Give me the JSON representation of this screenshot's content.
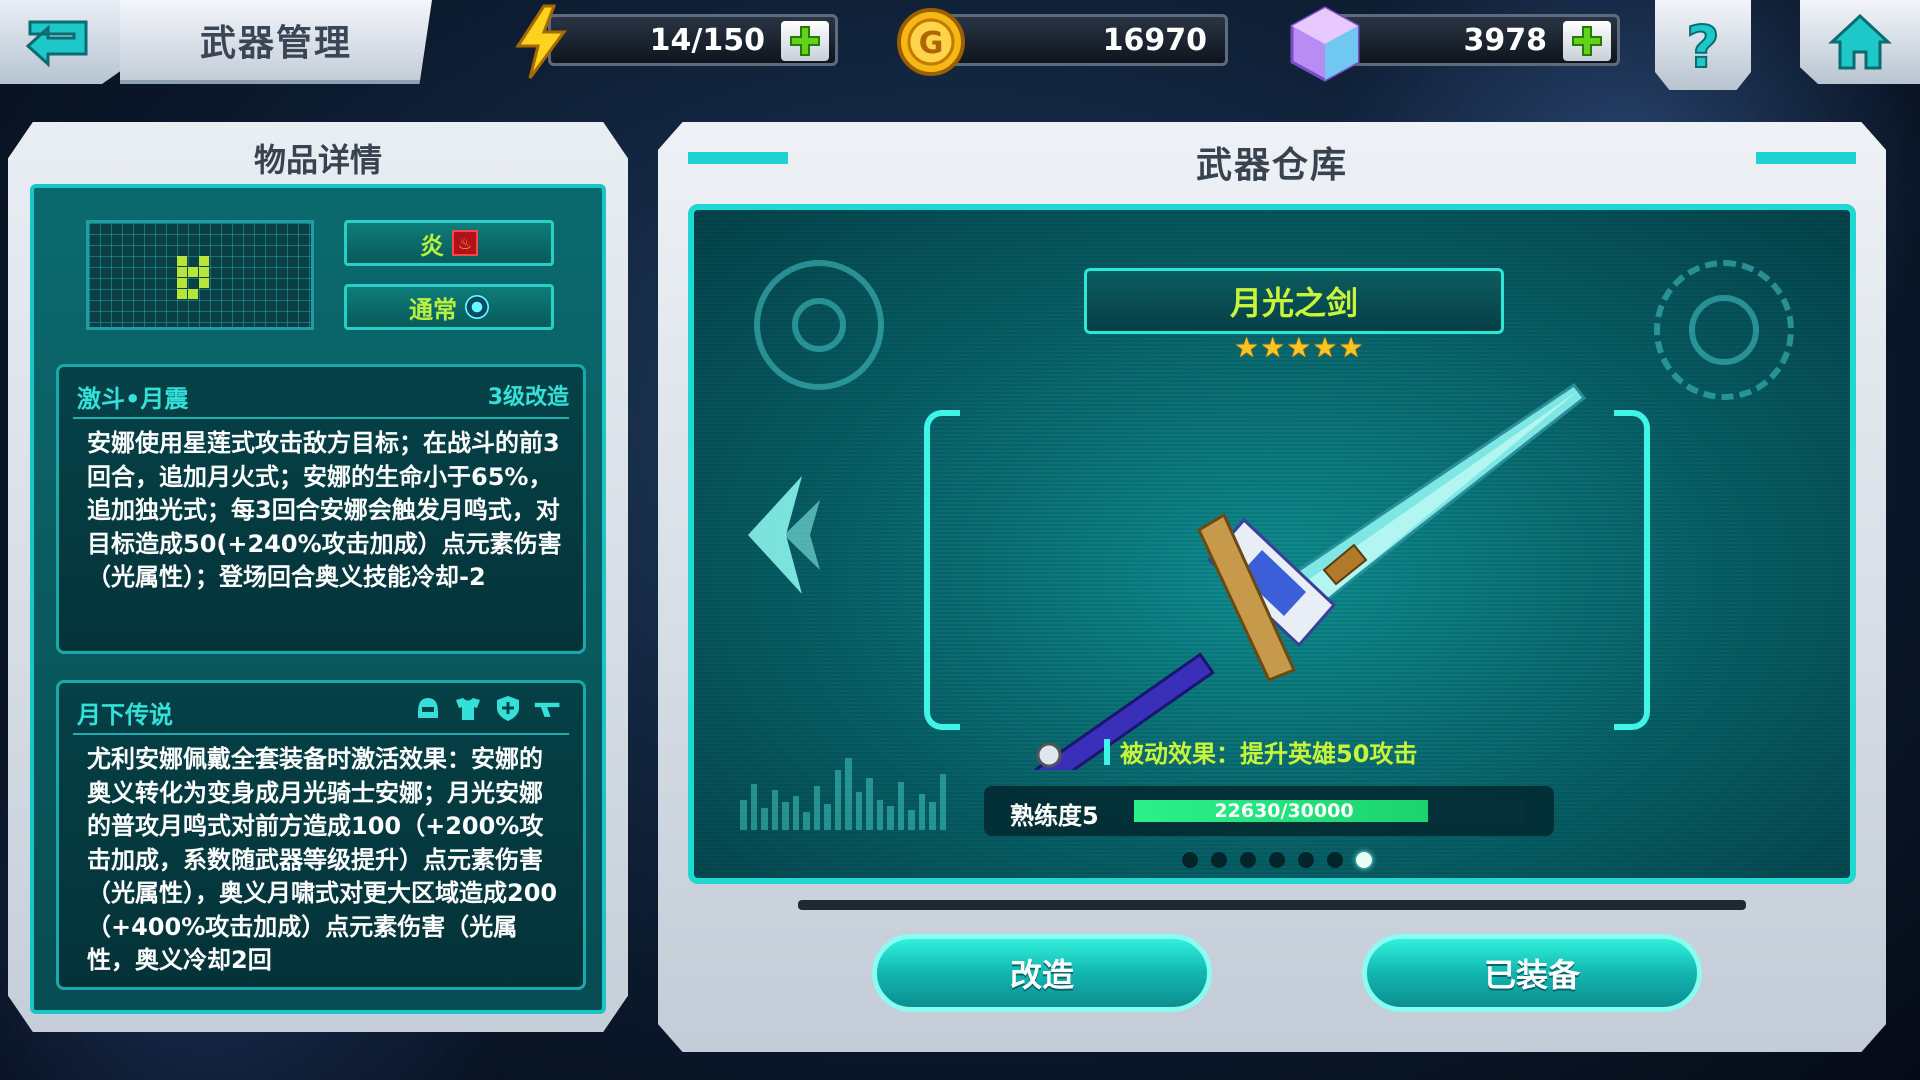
{
  "topbar": {
    "title": "武器管理",
    "energy": "14/150",
    "gold": "16970",
    "gems": "3978"
  },
  "item_details": {
    "header": "物品详情",
    "element_tag": "炎",
    "rarity_tag": "通常",
    "skill": {
      "name": "激斗•月震",
      "level": "3级改造",
      "description": "安娜使用星莲式攻击敌方目标；在战斗的前3回合，追加月火式；安娜的生命小于65%，追加独光式；每3回合安娜会触发月鸣式，对目标造成50(+240%攻击加成）点元素伤害（光属性）；登场回合奥义技能冷却-2"
    },
    "set_bonus": {
      "name": "月下传说",
      "icons": [
        "helmet-icon",
        "armor-icon",
        "shield-icon",
        "gun-icon"
      ],
      "description": "尤利安娜佩戴全套装备时激活效果：安娜的奥义转化为变身成月光骑士安娜；月光安娜的普攻月鸣式对前方造成100（+200%攻击加成，系数随武器等级提升）点元素伤害（光属性），奥义月啸式对更大区域造成200（+400%攻击加成）点元素伤害（光属性，奥义冷却2回"
    }
  },
  "armory": {
    "header": "武器仓库",
    "weapon_name": "月光之剑",
    "stars": 5,
    "passive": "被动效果：提升英雄50攻击",
    "proficiency_label": "熟练度5",
    "proficiency_text": "22630/30000",
    "proficiency_current": 22630,
    "proficiency_max": 30000,
    "page_count": 7,
    "active_page": 7,
    "upgrade_button": "改造",
    "equipped_button": "已装备"
  },
  "colors": {
    "accent_cyan": "#20d8d2",
    "label_green": "#c8f53a",
    "progress_green": "#2cf08a",
    "star_gold": "#ffc21e"
  }
}
